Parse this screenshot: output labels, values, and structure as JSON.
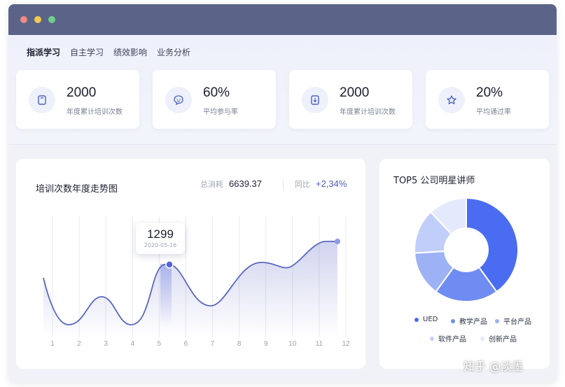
{
  "tabs": [
    {
      "label": "指派学习",
      "active": true
    },
    {
      "label": "自主学习",
      "active": false
    },
    {
      "label": "绩效影响",
      "active": false
    },
    {
      "label": "业务分析",
      "active": false
    }
  ],
  "stats": [
    {
      "value": "2000",
      "label": "年度累计培训次数",
      "icon": "book-icon"
    },
    {
      "value": "60%",
      "label": "平均参与率",
      "icon": "smile-icon"
    },
    {
      "value": "2000",
      "label": "年度累计培训次数",
      "icon": "download-doc-icon"
    },
    {
      "value": "20%",
      "label": "平均通过率",
      "icon": "star-icon"
    }
  ],
  "trend": {
    "title": "培训次数年度走势图",
    "total_label": "总消耗",
    "total_value": "6639.37",
    "compare_label": "同比",
    "compare_value": "+2,34%",
    "tooltip_value": "1299",
    "tooltip_date": "2020-05-16"
  },
  "chart_data": [
    {
      "type": "line",
      "title": "培训次数年度走势图",
      "xlabel": "",
      "ylabel": "",
      "x": [
        1,
        2,
        3,
        4,
        5,
        6,
        7,
        8,
        9,
        10,
        11,
        12
      ],
      "y_axis_labeled": false,
      "line_color": "#5a67c2",
      "highlight": {
        "value": "1299",
        "date": "2020-05-16"
      }
    },
    {
      "type": "pie",
      "title": "TOP5 公司明星讲师",
      "donut": true,
      "labels": [
        "UED",
        "教学产品",
        "平台产品",
        "软件产品",
        "创新产品"
      ],
      "values": [
        40,
        20,
        14,
        14,
        12
      ],
      "colors": [
        "#4a6cf0",
        "#6f8cf2",
        "#9db1f5",
        "#c2cefa",
        "#e4e9fc"
      ],
      "legend_position": "bottom"
    }
  ],
  "colors": {
    "accent": "#4a6cf0",
    "titlebar": "#5b6488",
    "positive": "#4a5fc1"
  },
  "watermark": "知乎 @淡墨"
}
